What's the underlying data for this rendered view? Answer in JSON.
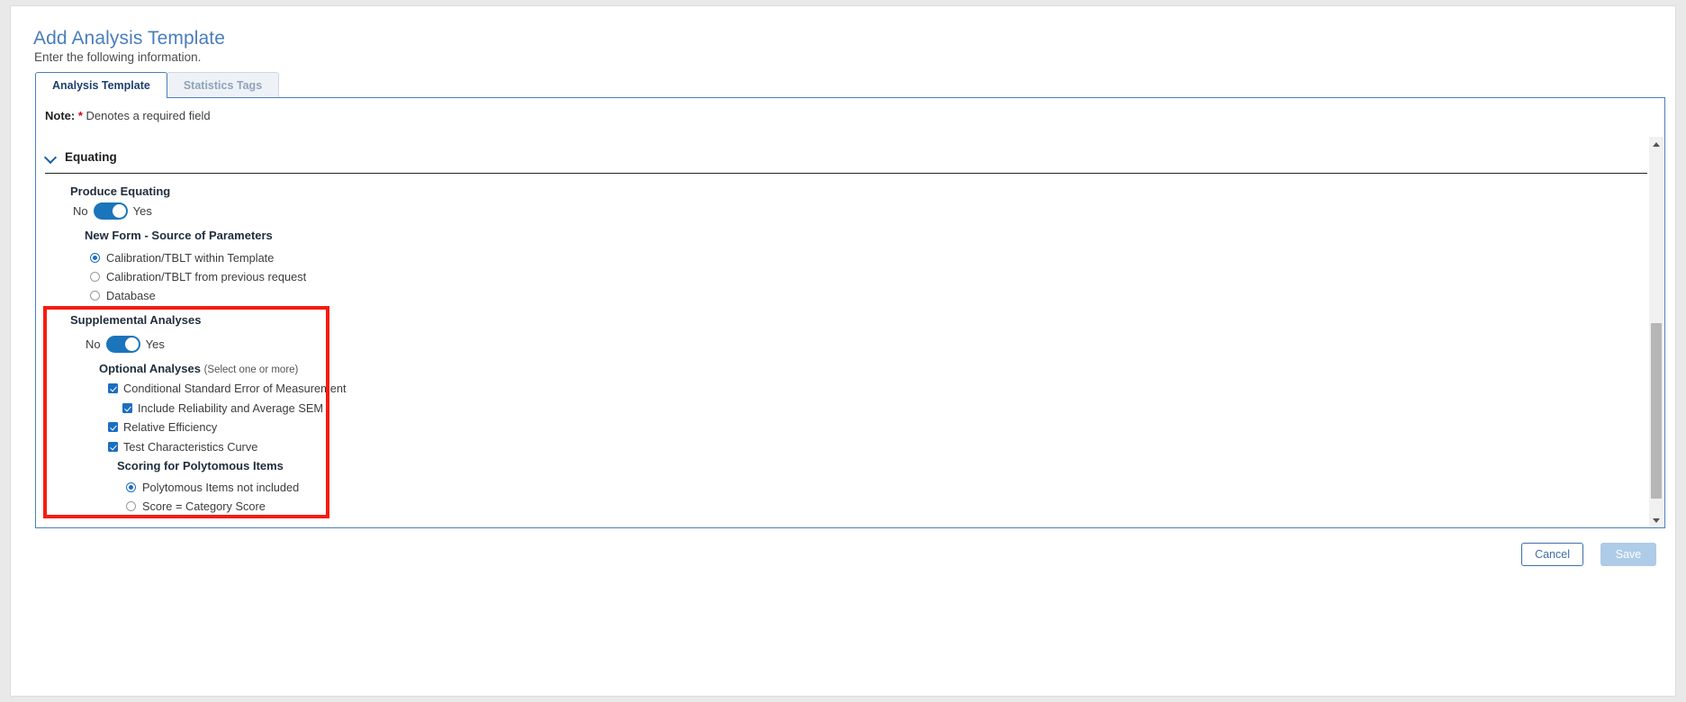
{
  "header": {
    "title": "Add Analysis Template",
    "subtitle": "Enter the following information."
  },
  "tabs": [
    {
      "label": "Analysis Template",
      "active": true
    },
    {
      "label": "Statistics Tags",
      "active": false
    }
  ],
  "note": {
    "prefix": "Note:",
    "star": "*",
    "text": "Denotes a required field"
  },
  "section": {
    "title": "Equating",
    "expanded": true
  },
  "produce_equating": {
    "label": "Produce Equating",
    "toggle": {
      "off_label": "No",
      "on_label": "Yes",
      "value": "Yes"
    }
  },
  "new_form": {
    "label": "New Form - Source of Parameters",
    "options": [
      {
        "label": "Calibration/TBLT within Template",
        "checked": true
      },
      {
        "label": "Calibration/TBLT from previous request",
        "checked": false
      },
      {
        "label": "Database",
        "checked": false
      }
    ]
  },
  "supplemental": {
    "label": "Supplemental Analyses",
    "toggle": {
      "off_label": "No",
      "on_label": "Yes",
      "value": "Yes"
    },
    "optional_label": "Optional Analyses",
    "optional_hint": "(Select one or more)",
    "checkboxes": [
      {
        "label": "Conditional Standard Error of Measurement",
        "checked": true,
        "indent": 0
      },
      {
        "label": "Include Reliability and Average SEM",
        "checked": true,
        "indent": 1
      },
      {
        "label": "Relative Efficiency",
        "checked": true,
        "indent": 0
      },
      {
        "label": "Test Characteristics Curve",
        "checked": true,
        "indent": 0
      }
    ],
    "scoring_label": "Scoring for Polytomous Items",
    "scoring_options": [
      {
        "label": "Polytomous Items not included",
        "checked": true
      },
      {
        "label": "Score = Category Score",
        "checked": false
      }
    ]
  },
  "footer": {
    "cancel_label": "Cancel",
    "save_label": "Save"
  },
  "scrollbar": {
    "up_icon": "triangle-up-icon",
    "down_icon": "triangle-down-icon"
  },
  "colors": {
    "accent": "#1b6ec2",
    "title": "#4a7ebb",
    "highlight": "#f61b10",
    "required": "#d0021b"
  }
}
